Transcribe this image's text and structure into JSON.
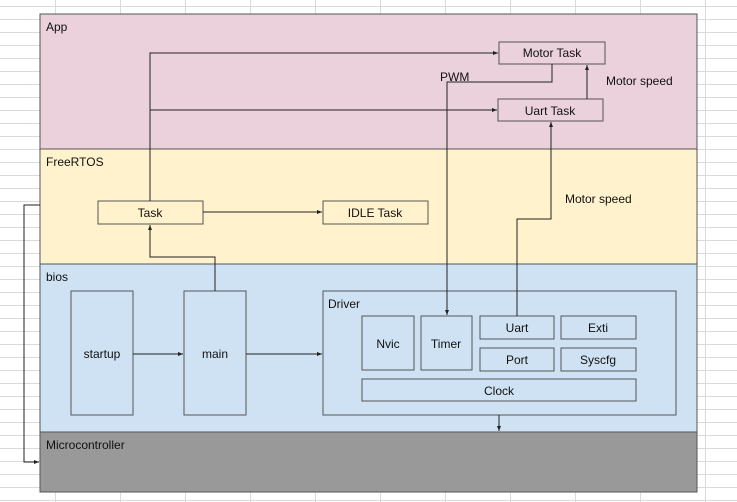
{
  "layers": {
    "app": "App",
    "freertos": "FreeRTOS",
    "bios": "bios",
    "micro": "Microcontroller"
  },
  "boxes": {
    "motor_task": "Motor Task",
    "uart_task": "Uart Task",
    "task": "Task",
    "idle_task": "IDLE Task",
    "startup": "startup",
    "main": "main",
    "driver": "Driver",
    "nvic": "Nvic",
    "timer": "Timer",
    "uart": "Uart",
    "exti": "Exti",
    "port": "Port",
    "syscfg": "Syscfg",
    "clock": "Clock"
  },
  "labels": {
    "pwm": "PWM",
    "motor_speed_1": "Motor speed",
    "motor_speed_2": "Motor speed"
  },
  "colors": {
    "app": "#ead1dc",
    "freertos": "#fff2cc",
    "bios": "#cfe2f3",
    "micro": "#999999"
  }
}
